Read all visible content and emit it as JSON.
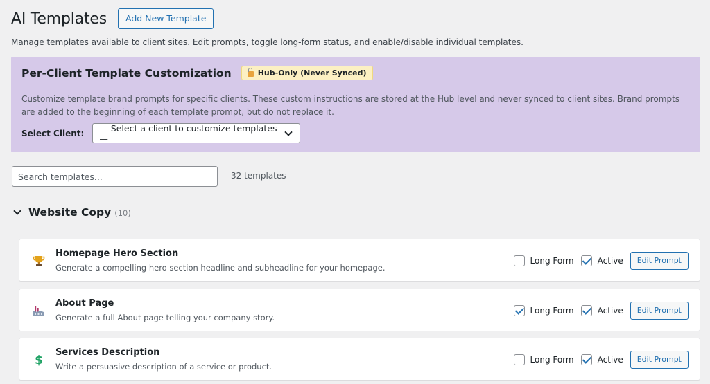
{
  "header": {
    "title": "AI Templates",
    "add_button": "Add New Template",
    "subtitle": "Manage templates available to client sites. Edit prompts, toggle long-form status, and enable/disable individual templates."
  },
  "customization": {
    "title": "Per-Client Template Customization",
    "badge": "Hub-Only (Never Synced)",
    "description": "Customize template brand prompts for specific clients. These custom instructions are stored at the Hub level and never synced to client sites. Brand prompts are added to the beginning of each template prompt, but do not replace it.",
    "client_label": "Select Client:",
    "client_select_value": "— Select a client to customize templates —",
    "background_color": "#d6c9e9"
  },
  "search": {
    "placeholder": "Search templates...",
    "count": "32 templates"
  },
  "section": {
    "title": "Website Copy",
    "count": "(10)"
  },
  "templates": [
    {
      "icon": "trophy-icon",
      "name": "Homepage Hero Section",
      "desc": "Generate a compelling hero section headline and subheadline for your homepage.",
      "long_form": false,
      "active": true,
      "long_form_label": "Long Form",
      "active_label": "Active",
      "edit_label": "Edit Prompt"
    },
    {
      "icon": "factory-icon",
      "name": "About Page",
      "desc": "Generate a full About page telling your company story.",
      "long_form": true,
      "active": true,
      "long_form_label": "Long Form",
      "active_label": "Active",
      "edit_label": "Edit Prompt"
    },
    {
      "icon": "dollar-icon",
      "name": "Services Description",
      "desc": "Write a persuasive description of a service or product.",
      "long_form": false,
      "active": true,
      "long_form_label": "Long Form",
      "active_label": "Active",
      "edit_label": "Edit Prompt"
    }
  ],
  "colors": {
    "accent": "#2271b1",
    "badge_bg": "#fcf0c3"
  }
}
